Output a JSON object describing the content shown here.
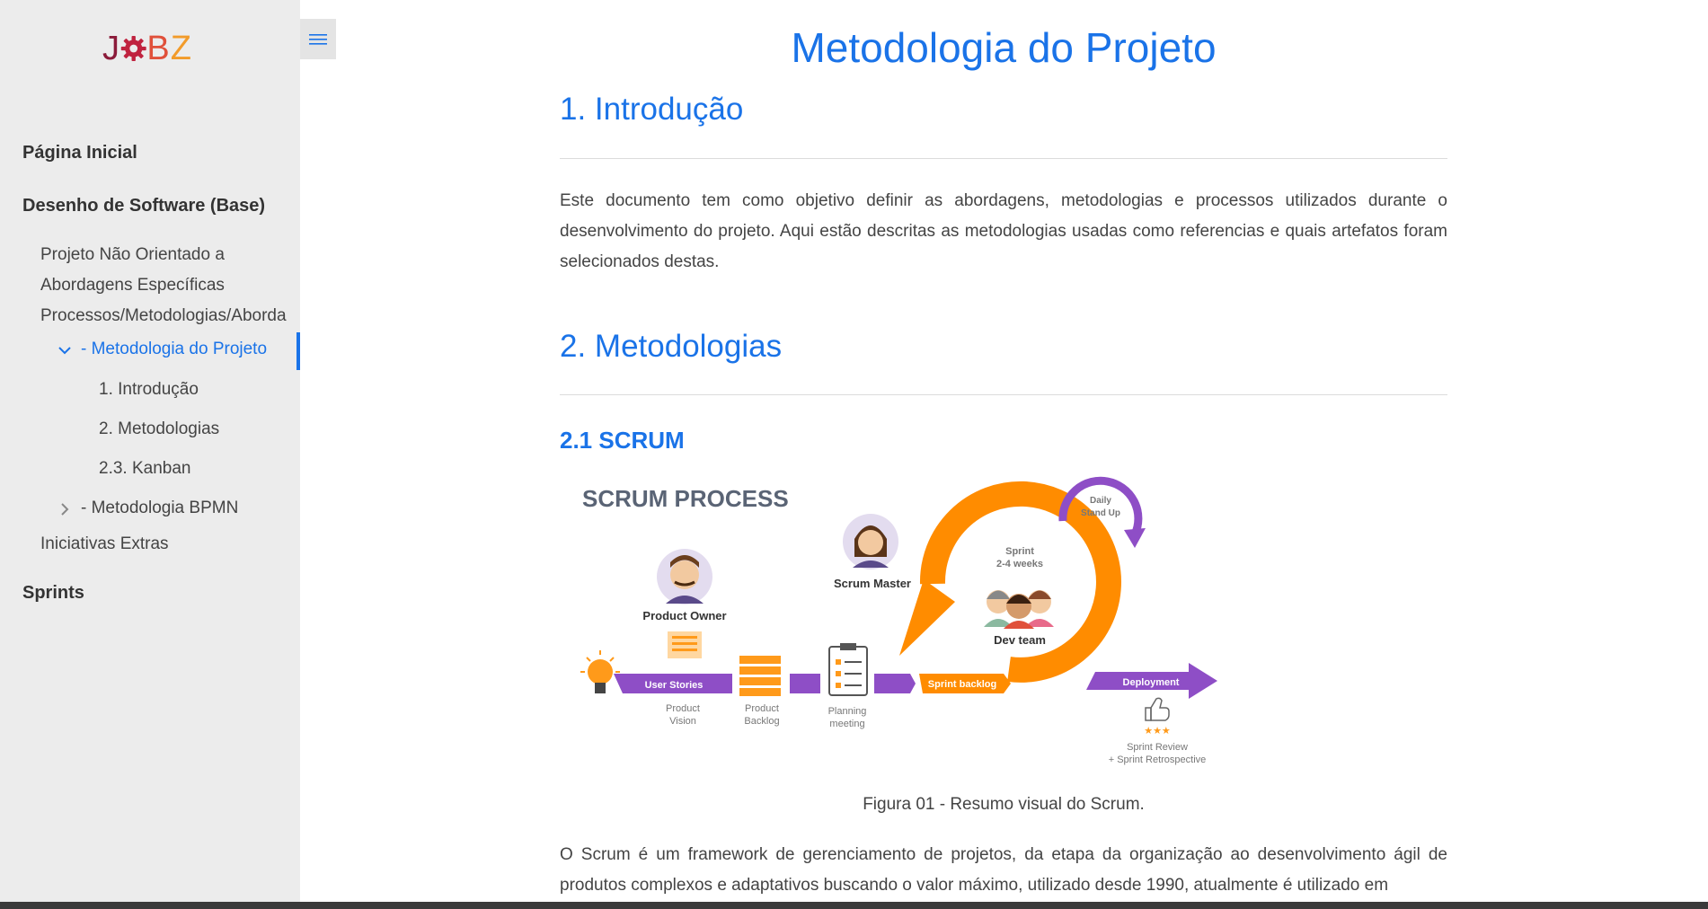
{
  "sidebar": {
    "logo_text": "JOBZ",
    "items": [
      {
        "label": "Página Inicial"
      },
      {
        "label": "Desenho de Software (Base)"
      },
      {
        "label": "Sprints"
      }
    ],
    "sub_items": [
      {
        "label": "Projeto Não Orientado a"
      },
      {
        "label": "Abordagens Específicas"
      },
      {
        "label": "Processos/Metodologias/Aborda"
      }
    ],
    "active_item": {
      "label": "- Metodologia do Projeto"
    },
    "active_children": [
      {
        "label": "1. Introdução"
      },
      {
        "label": "2. Metodologias"
      },
      {
        "label": "2.3. Kanban"
      }
    ],
    "collapsed_item": {
      "label": "- Metodologia BPMN"
    },
    "extras": {
      "label": "Iniciativas Extras"
    }
  },
  "page": {
    "title": "Metodologia do Projeto",
    "section1_heading": "1. Introdução",
    "section1_text": "Este documento tem como objetivo definir as abordagens, metodologias e processos utilizados durante o desenvolvimento do projeto. Aqui estão descritas as metodologias usadas como referencias e quais artefatos foram selecionados destas.",
    "section2_heading": "2. Metodologias",
    "subsection_heading": "2.1 SCRUM",
    "figure_caption": "Figura 01 - Resumo visual do Scrum.",
    "scrum_text": "O Scrum é um framework de gerenciamento de projetos, da etapa da organização ao desenvolvimento ágil de produtos complexos e adaptativos buscando o valor máximo, utilizado desde 1990, atualmente é utilizado em"
  },
  "figure": {
    "title": "SCRUM PROCESS",
    "product_owner": "Product Owner",
    "scrum_master": "Scrum Master",
    "dev_team": "Dev team",
    "sprint_line1": "Sprint",
    "sprint_line2": "2-4 weeks",
    "daily_line1": "Daily",
    "daily_line2": "Stand Up",
    "user_stories": "User Stories",
    "product_vision_1": "Product",
    "product_vision_2": "Vision",
    "product_backlog_1": "Product",
    "product_backlog_2": "Backlog",
    "planning_1": "Planning",
    "planning_2": "meeting",
    "sprint_backlog": "Sprint backlog",
    "deployment": "Deployment",
    "review_1": "Sprint Review",
    "review_2": "+ Sprint Retrospective"
  },
  "colors": {
    "accent": "#1a73e8",
    "sidebar_bg": "#ececec",
    "purple": "#8e4ec6",
    "orange": "#ff8c00"
  }
}
